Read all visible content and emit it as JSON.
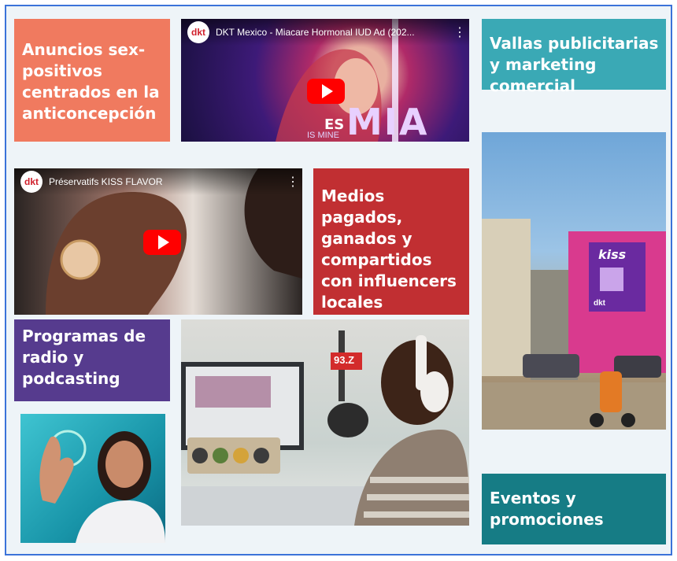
{
  "tiles": {
    "sex_positive_ads": "Anuncios sex-positivos centrados en la anticoncepción",
    "billboards": "Vallas publicitarias y marketing comercial",
    "paid_media": "Medios pagados, ganados y compartidos con influencers locales",
    "radio": "Programas de radio y podcasting",
    "events": "Eventos y promociones"
  },
  "videos": {
    "mexico": {
      "channel_logo": "dkt",
      "title": "DKT Mexico - Miacare Hormonal IUD Ad (202...",
      "overlay_es": "ES",
      "overlay_mia": "MIA",
      "overlay_sub": "IS MINE"
    },
    "kiss": {
      "channel_logo": "dkt",
      "title": "Préservatifs KISS FLAVOR"
    }
  },
  "photos": {
    "radio_sign": "93.Z",
    "billboard_brand": "kiss",
    "billboard_logo": "dkt"
  },
  "colors": {
    "salmon": "#f07a5f",
    "dark_red": "#c12f32",
    "purple": "#563b8e",
    "teal_light": "#3aa9b5",
    "teal_dark": "#167c85",
    "frame": "#3b73d9"
  },
  "icons": {
    "play": "youtube-play-icon",
    "menu": "vertical-dots-icon"
  }
}
